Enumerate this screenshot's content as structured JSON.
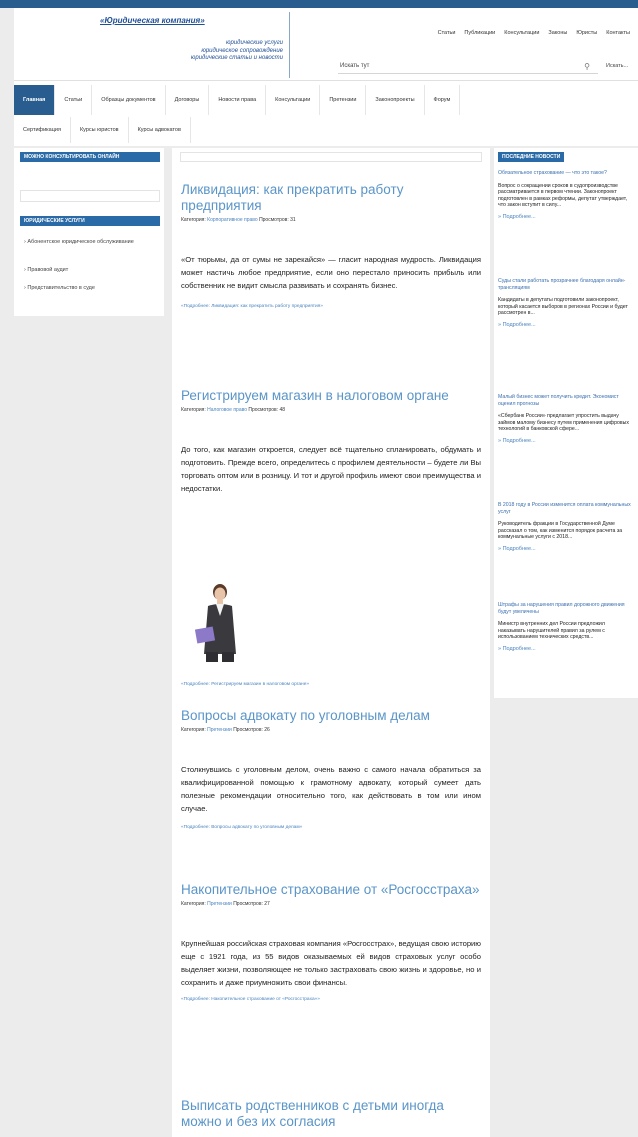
{
  "header": {
    "logo_title": "«Юридическая компания»",
    "logo_lines": [
      "юридические услуги",
      "юридическое сопровождение",
      "юридические статьи и новости"
    ],
    "top_links": [
      "Статьи",
      "Публикации",
      "Консультации",
      "Законы",
      "Юристы",
      "Контакты"
    ],
    "search_placeholder": "Искать тут",
    "search_button": "Искать..."
  },
  "nav": {
    "row1": [
      "Главная",
      "Статьи",
      "Образцы документов",
      "Договоры",
      "Новости права",
      "Консультации",
      "Претензии",
      "Законопроекты",
      "Форум"
    ],
    "row2": [
      "Сертификация",
      "Курсы юристов",
      "Курсы адвокатов"
    ]
  },
  "left": {
    "box1_title": "МОЖНО КОНСУЛЬТИРОВАТЬ ОНЛАЙН",
    "box2_title": "ЮРИДИЧЕСКИЕ УСЛУГИ",
    "items": [
      "Абонентское юридическое обслуживание",
      "Правовой аудит",
      "Представительство в суде"
    ]
  },
  "articles": [
    {
      "title": "Ликвидация: как прекратить работу предприятия",
      "meta_label": "Категория:",
      "category": "Корпоративное право",
      "views": "Просмотров: 31",
      "text": "«От тюрьмы, да от сумы не зарекайся» — гласит народная мудрость. Ликвидация может настичь любое предприятие, если оно перестало приносить прибыль или собственник не видит смысла развивать и сохранять бизнес.",
      "more": "«Подробнее: Ликвидация: как прекратить работу предприятия»"
    },
    {
      "title": "Регистрируем магазин в налоговом органе",
      "meta_label": "Категория:",
      "category": "Налоговое право",
      "views": "Просмотров: 48",
      "text": "До того, как магазин откроется, следует всё тщательно спланировать, обдумать и подготовить. Прежде всего, определитесь с профилем деятельности – будете ли Вы торговать оптом или в розницу. И тот и другой профиль имеют свои преимущества и недостатки.",
      "more": "«Подробнее: Регистрируем магазин в налоговом органе»"
    },
    {
      "title": "Вопросы адвокату по уголовным делам",
      "meta_label": "Категория:",
      "category": "Претензии",
      "views": "Просмотров: 26",
      "text": "Столкнувшись с уголовным делом, очень важно с самого начала обратиться за квалифицированной помощью к грамотному адвокату, который сумеет дать полезные рекомендации относительно того, как действовать в том или ином случае.",
      "more": "«Подробнее: Вопросы адвокату по уголовным делам»"
    },
    {
      "title": "Накопительное страхование от «Росгосстраха»",
      "meta_label": "Категория:",
      "category": "Претензии",
      "views": "Просмотров: 27",
      "text": "Крупнейшая российская страховая компания «Росгосстрах», ведущая свою историю еще с 1921 года, из 55 видов оказываемых ей видов страховых услуг особо выделяет жизни, позволяющее не только застраховать свою жизнь и здоровье, но и сохранить и даже приумножить свои финансы.",
      "more": "«Подробнее: Накопительное страхование от «Росгосстраха»»"
    },
    {
      "title": "Выписать родственников с детьми иногда можно и без их согласия"
    }
  ],
  "right": {
    "title": "ПОСЛЕДНИЕ НОВОСТИ",
    "more_label": "Подробнее...",
    "news": [
      {
        "title": "Обязательное страхование — что это такое?",
        "text": "Вопрос о сокращении сроков в судопроизводстве рассматривается в первом чтении. Законопроект подготовлен в рамках реформы, депутат утверждает, что закон вступит в силу..."
      },
      {
        "title": "Суды стали работать прозрачнее благодаря онлайн-трансляциям",
        "text": "Кандидаты в депутаты подготовили законопроект, который касается выборов в регионах России и будет рассмотрен в..."
      },
      {
        "title": "Малый бизнес может получить кредит. Экономист оценил прогнозы",
        "text": "«Сбербанк России» предлагает упростить выдачу займов малому бизнесу путем применения цифровых технологий в банковской сфере..."
      },
      {
        "title": "В 2018 году в России изменится оплата коммунальных услуг",
        "text": "Руководитель фракции в Государственной Думе рассказал о том, как изменится порядок расчета за коммунальные услуги с 2018..."
      },
      {
        "title": "Штрафы за нарушения правил дорожного движения будут увеличены",
        "text": "Министр внутренних дел России предложил наказывать нарушителей правил за рулем с использованием технических средств..."
      }
    ]
  }
}
